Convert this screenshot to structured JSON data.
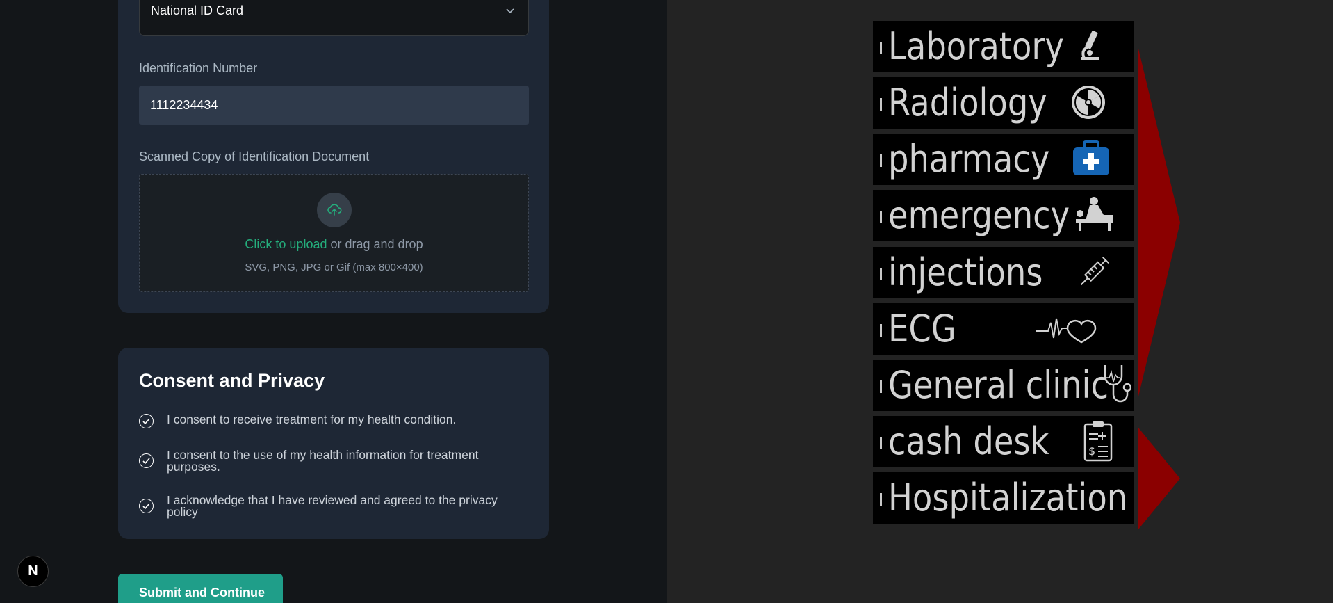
{
  "identification": {
    "id_type_value": "National ID Card",
    "id_number_label": "Identification Number",
    "id_number_value": "1112234434",
    "scan_label": "Scanned Copy of Identification Document",
    "upload_link": "Click to upload",
    "upload_rest": " or drag and drop",
    "upload_hint": "SVG, PNG, JPG or Gif (max 800×400)"
  },
  "consent": {
    "title": "Consent and Privacy",
    "items": [
      "I consent to receive treatment for my health condition.",
      "I consent to the use of my health information for treatment purposes.",
      "I acknowledge that I have reviewed and agreed to the privacy policy"
    ]
  },
  "submit_label": "Submit and Continue",
  "badge_letter": "N",
  "signpost": {
    "departments": [
      {
        "label": "Laboratory",
        "icon": "microscope-icon"
      },
      {
        "label": "Radiology",
        "icon": "radiation-icon"
      },
      {
        "label": "pharmacy",
        "icon": "first-aid-kit-icon"
      },
      {
        "label": "emergency",
        "icon": "stretcher-patient-icon"
      },
      {
        "label": "injections",
        "icon": "syringe-icon"
      },
      {
        "label": "ECG",
        "icon": "heartbeat-icon"
      },
      {
        "label": "General clinic",
        "icon": "stethoscope-icon"
      },
      {
        "label": "cash desk",
        "icon": "bill-clipboard-icon"
      },
      {
        "label": "Hospitalization",
        "icon": ""
      }
    ]
  },
  "colors": {
    "accent_green": "#24ae7c",
    "button_teal": "#1f9e89",
    "arrow_red": "#8b0000",
    "pharmacy_blue": "#1565b5"
  }
}
